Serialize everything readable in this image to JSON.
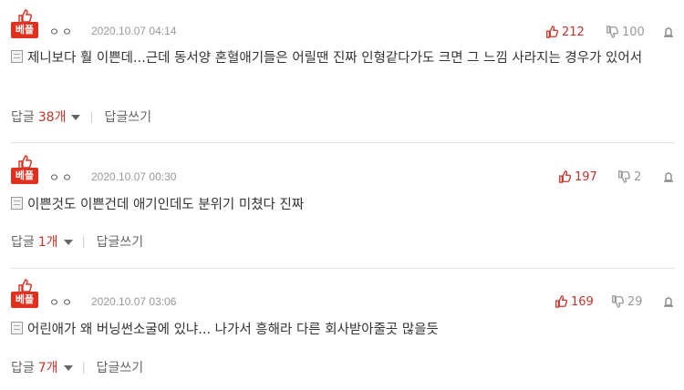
{
  "badge_label": "베플",
  "comments": [
    {
      "nickname": "ㅇㅇ",
      "date": "2020.10.07 04:14",
      "upvotes": "212",
      "downvotes": "100",
      "text": "제니보다 훨 이쁜데...근데 동서양 혼혈애기들은 어릴땐 진짜 인형같다가도 크면 그 느낌 사라지는 경우가 있어서",
      "reply_label": "답글",
      "reply_count": "38개",
      "write_reply": "답글쓰기"
    },
    {
      "nickname": "ㅇㅇ",
      "date": "2020.10.07 00:30",
      "upvotes": "197",
      "downvotes": "2",
      "text": "이쁜것도 이쁜건데 애기인데도 분위기 미쳤다 진짜",
      "reply_label": "답글",
      "reply_count": "1개",
      "write_reply": "답글쓰기"
    },
    {
      "nickname": "ㅇㅇ",
      "date": "2020.10.07 03:06",
      "upvotes": "169",
      "downvotes": "29",
      "text": "어린애가 왜 버닝썬소굴에 있냐... 나가서 흥해라 다른 회사받아줄곳 많을듯",
      "reply_label": "답글",
      "reply_count": "7개",
      "write_reply": "답글쓰기"
    }
  ],
  "colors": {
    "badge": "#e0301e",
    "upvote": "#c8332a",
    "muted": "#999999"
  }
}
